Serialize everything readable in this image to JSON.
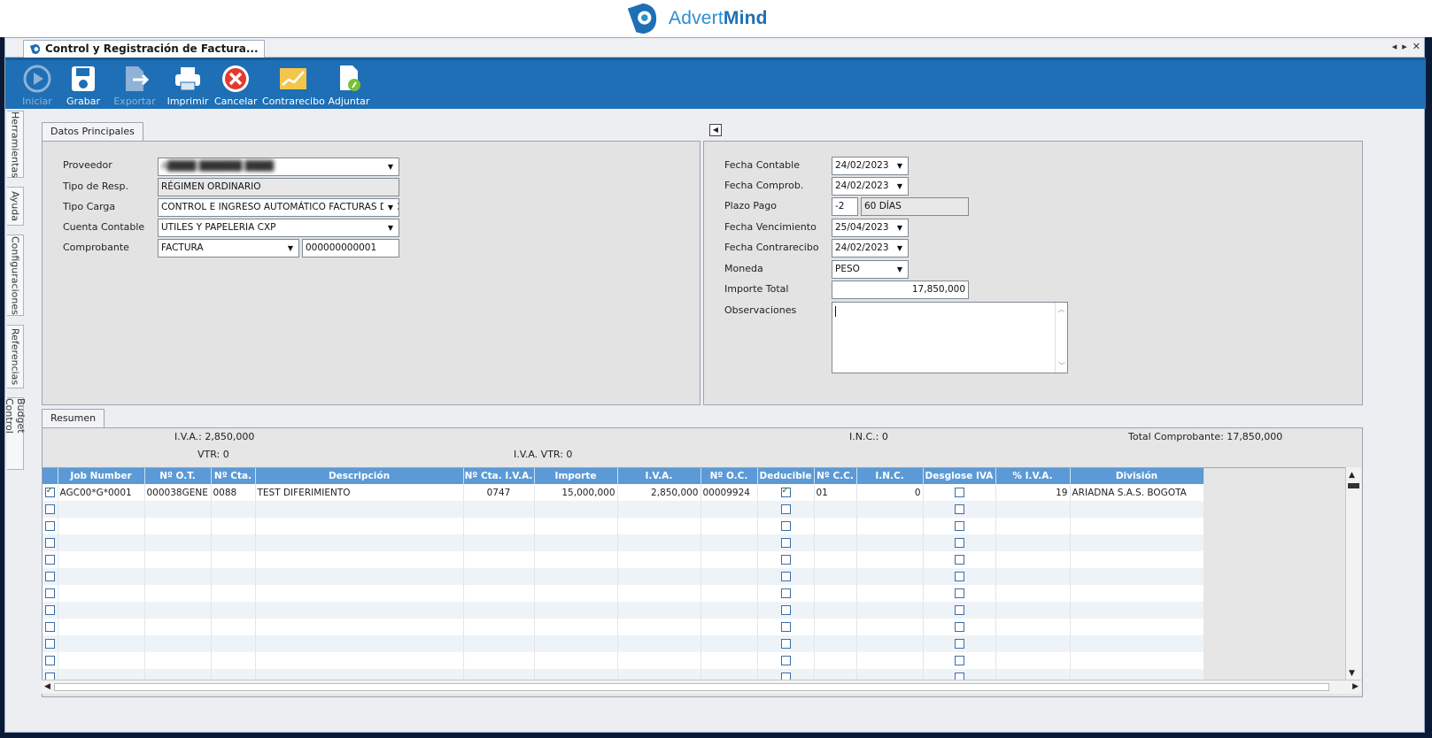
{
  "brand": {
    "name_light": "Advert",
    "name_bold": "Mind",
    "color": "#2b8fd0"
  },
  "window": {
    "tab_title": "Control y Registración de Factura...",
    "controls": {
      "prev": "◂",
      "next": "▸",
      "close": "✕"
    }
  },
  "toolbar": {
    "buttons": [
      {
        "label": "Iniciar",
        "icon": "play-icon",
        "enabled": false
      },
      {
        "label": "Grabar",
        "icon": "save-icon",
        "enabled": true
      },
      {
        "label": "Exportar",
        "icon": "export-icon",
        "enabled": false
      },
      {
        "label": "Imprimir",
        "icon": "printer-icon",
        "enabled": true
      },
      {
        "label": "Cancelar",
        "icon": "cancel-icon",
        "enabled": true
      },
      {
        "label": "Contrarecibo",
        "icon": "chart-icon",
        "enabled": true
      },
      {
        "label": "Adjuntar",
        "icon": "attach-document-icon",
        "enabled": true
      }
    ],
    "accent": "#1e6fb5"
  },
  "side_tabs": [
    "Herramientas",
    "Ayuda",
    "Configuraciones",
    "Referencias",
    "Budget Control"
  ],
  "datos": {
    "tab_label": "Datos Principales",
    "left": {
      "proveedor_label": "Proveedor",
      "proveedor_value": "A████ ██████ ████",
      "tipo_resp_label": "Tipo de Resp.",
      "tipo_resp_value": "RÉGIMEN ORDINARIO",
      "tipo_carga_label": "Tipo Carga",
      "tipo_carga_value": "CONTROL E INGRESO AUTOMÁTICO FACTURAS DE GASTOS",
      "cuenta_label": "Cuenta Contable",
      "cuenta_value": "UTILES Y PAPELERIA CXP",
      "comprobante_label": "Comprobante",
      "comprobante_type": "FACTURA",
      "comprobante_number": "000000000001"
    },
    "right": {
      "fecha_contable_label": "Fecha Contable",
      "fecha_contable": "24/02/2023",
      "fecha_comprob_label": "Fecha Comprob.",
      "fecha_comprob": "24/02/2023",
      "plazo_label": "Plazo Pago",
      "plazo_code": "-2",
      "plazo_desc": "60 DÍAS",
      "vencimiento_label": "Fecha Vencimiento",
      "vencimiento": "25/04/2023",
      "contrarecibo_label": "Fecha Contrarecibo",
      "contrarecibo": "24/02/2023",
      "moneda_label": "Moneda",
      "moneda": "PESO",
      "importe_label": "Importe Total",
      "importe": "17,850,000",
      "observaciones_label": "Observaciones",
      "observaciones": ""
    }
  },
  "resumen": {
    "tab_label": "Resumen",
    "iva": "I.V.A.: 2,850,000",
    "vtr": "VTR: 0",
    "inc": "I.N.C.: 0",
    "iva_vtr": "I.V.A. VTR: 0",
    "total": "Total Comprobante: 17,850,000"
  },
  "grid": {
    "columns": [
      "Job Number",
      "Nº O.T.",
      "Nº Cta.",
      "Descripción",
      "Nº Cta. I.V.A.",
      "Importe",
      "I.V.A.",
      "Nº O.C.",
      "Deducible",
      "Nº C.C.",
      "I.N.C.",
      "Desglose IVA",
      "% I.V.A.",
      "División"
    ],
    "rows": [
      {
        "checked": true,
        "job": "AGC00*G*0001",
        "ot": "000038GENE",
        "cta": "0088",
        "desc": "TEST DIFERIMIENTO",
        "cta_iva": "0747",
        "importe": "15,000,000",
        "iva": "2,850,000",
        "oc": "00009924",
        "deducible": true,
        "cc": "01",
        "inc": "0",
        "desglose": false,
        "pct_iva": "19",
        "division": "ARIADNA S.A.S. BOGOTA"
      },
      {
        "checked": false
      },
      {
        "checked": false
      },
      {
        "checked": false
      },
      {
        "checked": false
      },
      {
        "checked": false
      },
      {
        "checked": false
      },
      {
        "checked": false
      },
      {
        "checked": false
      },
      {
        "checked": false
      },
      {
        "checked": false
      },
      {
        "checked": false
      }
    ]
  }
}
